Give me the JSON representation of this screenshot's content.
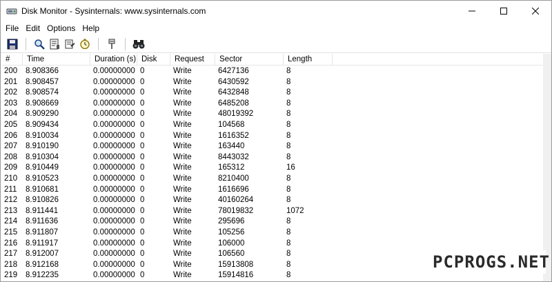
{
  "window": {
    "title": "Disk Monitor - Sysinternals: www.sysinternals.com",
    "controls": {
      "minimize": "minimize-icon",
      "maximize": "maximize-icon",
      "close": "close-icon"
    }
  },
  "menu": {
    "items": [
      "File",
      "Edit",
      "Options",
      "Help"
    ]
  },
  "toolbar": {
    "icons": [
      "save-icon",
      "magnifier-icon",
      "clear-list-icon",
      "filter-icon",
      "timer-icon",
      "pin-icon",
      "binoculars-icon"
    ]
  },
  "table": {
    "columns": [
      "#",
      "Time",
      "Duration (s)",
      "Disk",
      "Request",
      "Sector",
      "Length"
    ],
    "rows": [
      [
        "200",
        "8.908366",
        "0.00000000",
        "0",
        "Write",
        "6427136",
        "8"
      ],
      [
        "201",
        "8.908457",
        "0.00000000",
        "0",
        "Write",
        "6430592",
        "8"
      ],
      [
        "202",
        "8.908574",
        "0.00000000",
        "0",
        "Write",
        "6432848",
        "8"
      ],
      [
        "203",
        "8.908669",
        "0.00000000",
        "0",
        "Write",
        "6485208",
        "8"
      ],
      [
        "204",
        "8.909290",
        "0.00000000",
        "0",
        "Write",
        "48019392",
        "8"
      ],
      [
        "205",
        "8.909434",
        "0.00000000",
        "0",
        "Write",
        "104568",
        "8"
      ],
      [
        "206",
        "8.910034",
        "0.00000000",
        "0",
        "Write",
        "1616352",
        "8"
      ],
      [
        "207",
        "8.910190",
        "0.00000000",
        "0",
        "Write",
        "163440",
        "8"
      ],
      [
        "208",
        "8.910304",
        "0.00000000",
        "0",
        "Write",
        "8443032",
        "8"
      ],
      [
        "209",
        "8.910449",
        "0.00000000",
        "0",
        "Write",
        "165312",
        "16"
      ],
      [
        "210",
        "8.910523",
        "0.00000000",
        "0",
        "Write",
        "8210400",
        "8"
      ],
      [
        "211",
        "8.910681",
        "0.00000000",
        "0",
        "Write",
        "1616696",
        "8"
      ],
      [
        "212",
        "8.910826",
        "0.00000000",
        "0",
        "Write",
        "40160264",
        "8"
      ],
      [
        "213",
        "8.911441",
        "0.00000000",
        "0",
        "Write",
        "78019832",
        "1072"
      ],
      [
        "214",
        "8.911636",
        "0.00000000",
        "0",
        "Write",
        "295696",
        "8"
      ],
      [
        "215",
        "8.911807",
        "0.00000000",
        "0",
        "Write",
        "105256",
        "8"
      ],
      [
        "216",
        "8.911917",
        "0.00000000",
        "0",
        "Write",
        "106000",
        "8"
      ],
      [
        "217",
        "8.912007",
        "0.00000000",
        "0",
        "Write",
        "106560",
        "8"
      ],
      [
        "218",
        "8.912168",
        "0.00000000",
        "0",
        "Write",
        "15913808",
        "8"
      ],
      [
        "219",
        "8.912235",
        "0.00000000",
        "0",
        "Write",
        "15914816",
        "8"
      ]
    ]
  },
  "watermark": {
    "text": "PCPROGS.NET"
  }
}
